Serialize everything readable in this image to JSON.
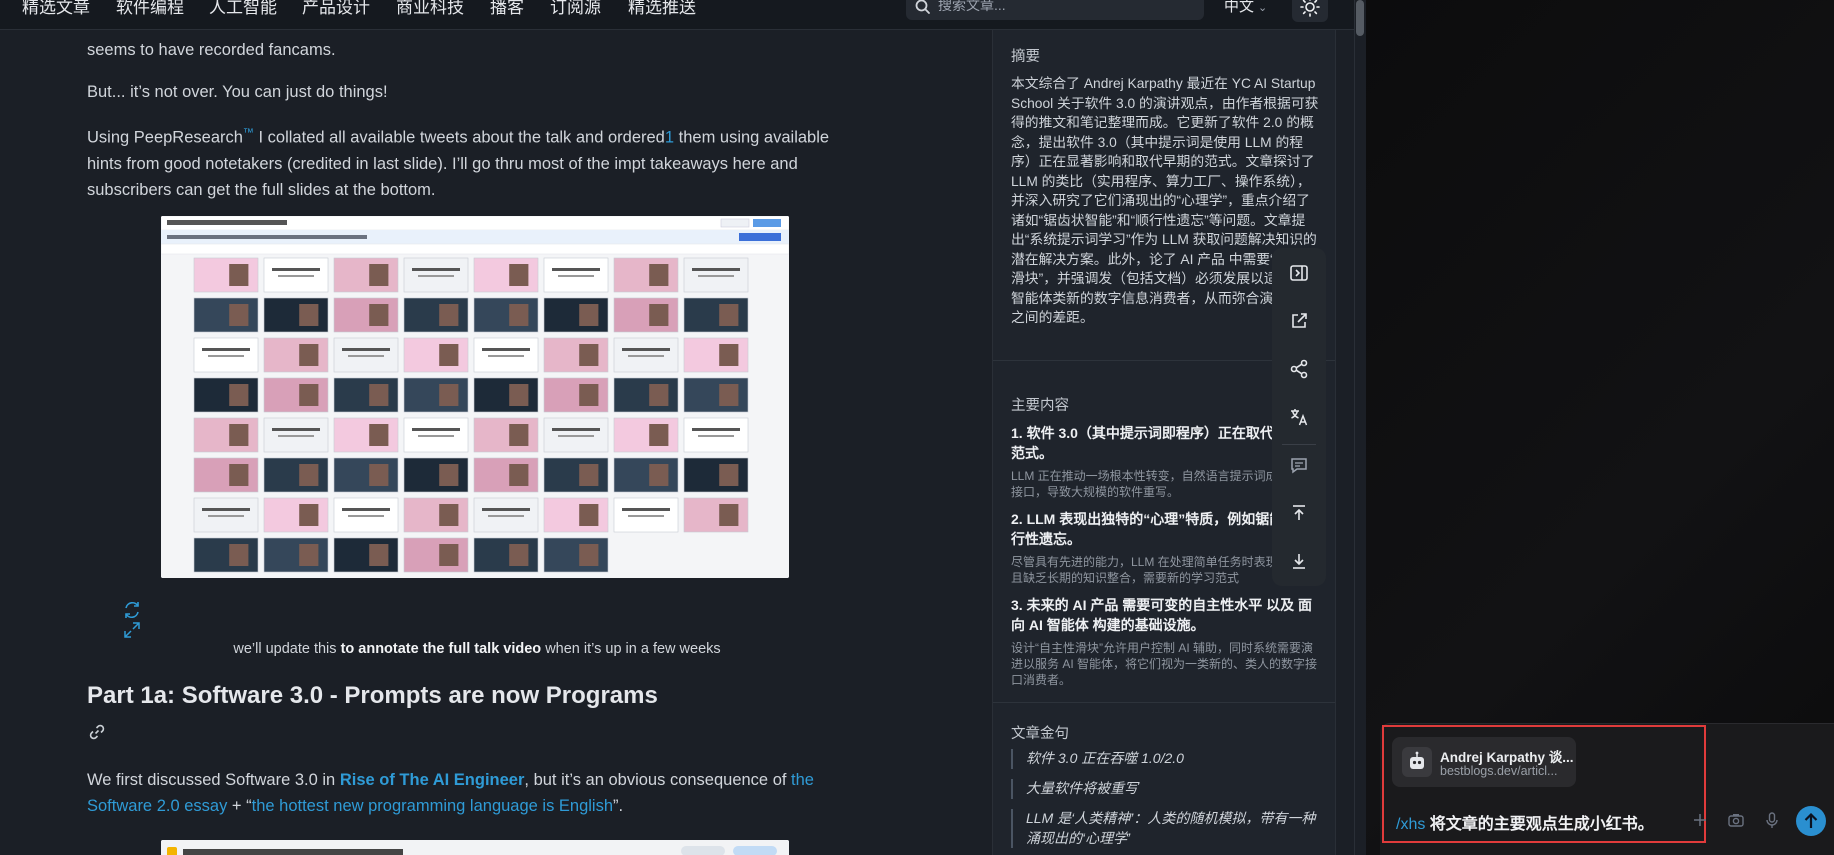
{
  "nav": {
    "items": [
      "精选文章",
      "软件编程",
      "人工智能",
      "产品设计",
      "商业科技",
      "播客",
      "订阅源",
      "精选推送"
    ],
    "search_placeholder": "搜索文章...",
    "language": "中文"
  },
  "article": {
    "para1": "seems to have recorded fancams.",
    "para2": "But... it’s not over. You can just do things!",
    "para3_a": "Using PeepResearch",
    "para3_tm": "™",
    "para3_b": " I collated all available tweets about the talk and ordered",
    "para3_fn": "1",
    "para3_c": " them using available hints from good notetakers (credited in last slide). I’ll go thru most of the impt takeaways here and subscribers can get the full slides at the bottom.",
    "caption_a": "we’ll update this ",
    "caption_b": "to annotate the full talk video",
    "caption_c": " when it’s up in a few weeks",
    "heading": "Part 1a: Software 3.0 - Prompts are now Programs",
    "para4_a": "We first discussed Software 3.0 in ",
    "para4_link1": "Rise of The AI Engineer",
    "para4_b": ", but it’s an obvious consequence of ",
    "para4_link2": "the Software 2.0 essay",
    "para4_c": " + “",
    "para4_link3": "the hottest new programming language is English",
    "para4_d": "”."
  },
  "summary": {
    "title": "摘要",
    "body": "本文综合了 Andrej Karpathy 最近在 YC AI Startup School 关于软件 3.0 的演讲观点，由作者根据可获得的推文和笔记整理而成。它更新了软件 2.0 的概念，提出软件 3.0（其中提示词是使用 LLM 的程序）正在显著影响和取代早期的范式。文章探讨了 LLM 的类比（实用程序、算力工厂、操作系统），并深入研究了它们涌现出的“心理学”，重点介绍了诸如“锯齿状智能”和“顺行性遗忘”等问题。文章提出“系统提示词学习”作为 LLM 获取问题解决知识的潜在解决方案。此外，论了 AI 产品 中需要“自主性滑块”，并强调发（包括文档）必须发展以适应 AI 智能体类新的数字信息消费者，从而弥合演示和可之间的差距。",
    "main_title": "主要内容",
    "points": [
      {
        "title": "1. 软件 3.0（其中提示词即程序）正在取代 1.0/2.0 范式。",
        "desc": "LLM 正在推动一场根本性转变，自然语言提示词成的编程接口，导致大规模的软件重写。"
      },
      {
        "title": "2. LLM 表现出独特的“心理”特质，例如锯能和顺行性遗忘。",
        "desc": "尽管具有先进的能力，LLM 在处理简单任务时表现定，并且缺乏长期的知识整合，需要新的学习范式"
      },
      {
        "title": "3. 未来的 AI 产品 需要可变的自主性水平 以及 面向 AI 智能体 构建的基础设施。",
        "desc": "设计“自主性滑块”允许用户控制 AI 辅助，同时系统需要演进以服务 AI 智能体，将它们视为一类新的、类人的数字接口消费者。"
      }
    ],
    "quotes_title": "文章金句",
    "quotes": [
      "软件 3.0 正在吞噬 1.0/2.0",
      "大量软件将被重写",
      "LLM 是‘人类精神’：人类的随机模拟，带有一种涌现出的‘心理学’"
    ]
  },
  "toolbar": {
    "icons": [
      "sidebar-panel-icon",
      "external-link-icon",
      "share-icon",
      "translate-icon",
      "comment-icon",
      "scroll-top-icon",
      "download-icon"
    ]
  },
  "chat": {
    "attachment_title": "Andrej Karpathy 谈...",
    "attachment_url": "bestblogs.dev/articl...",
    "prompt_command": "/xhs",
    "prompt_text": " 将文章的主要观点生成小红书。"
  },
  "colors": {
    "link": "#2f9bd6",
    "send_button": "#2a8fd0",
    "highlight_border": "#e03b3b"
  }
}
